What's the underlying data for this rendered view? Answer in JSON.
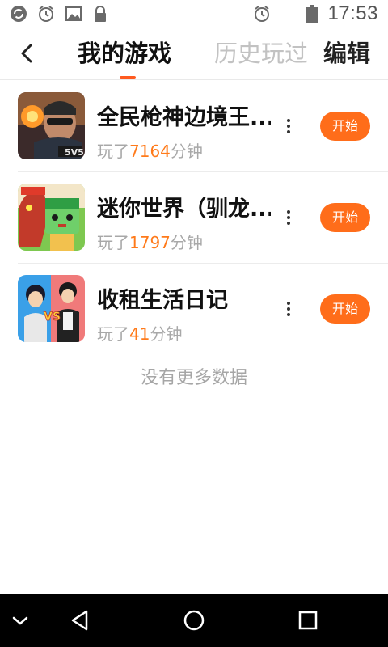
{
  "status_bar": {
    "time": "17:53",
    "left_icons": [
      "sync-icon",
      "alarm-icon",
      "image-icon",
      "lock-icon"
    ],
    "right_icons": [
      "alarm-icon",
      "battery-icon"
    ]
  },
  "header": {
    "tab_active": "我的游戏",
    "tab_inactive": "历史玩过",
    "edit_label": "编辑"
  },
  "games": [
    {
      "title": "全民枪神边境王...",
      "played_prefix": "玩了",
      "played_minutes": "7164",
      "played_suffix": "分钟",
      "button": "开始"
    },
    {
      "title": "迷你世界（驯龙...",
      "played_prefix": "玩了",
      "played_minutes": "1797",
      "played_suffix": "分钟",
      "button": "开始"
    },
    {
      "title": "收租生活日记",
      "played_prefix": "玩了",
      "played_minutes": "41",
      "played_suffix": "分钟",
      "button": "开始"
    }
  ],
  "footer_text": "没有更多数据",
  "colors": {
    "accent": "#ff6d1a",
    "minutes": "#ff7a1a"
  },
  "nav": [
    "chevron-down-icon",
    "back-triangle-icon",
    "home-circle-icon",
    "recents-square-icon"
  ]
}
